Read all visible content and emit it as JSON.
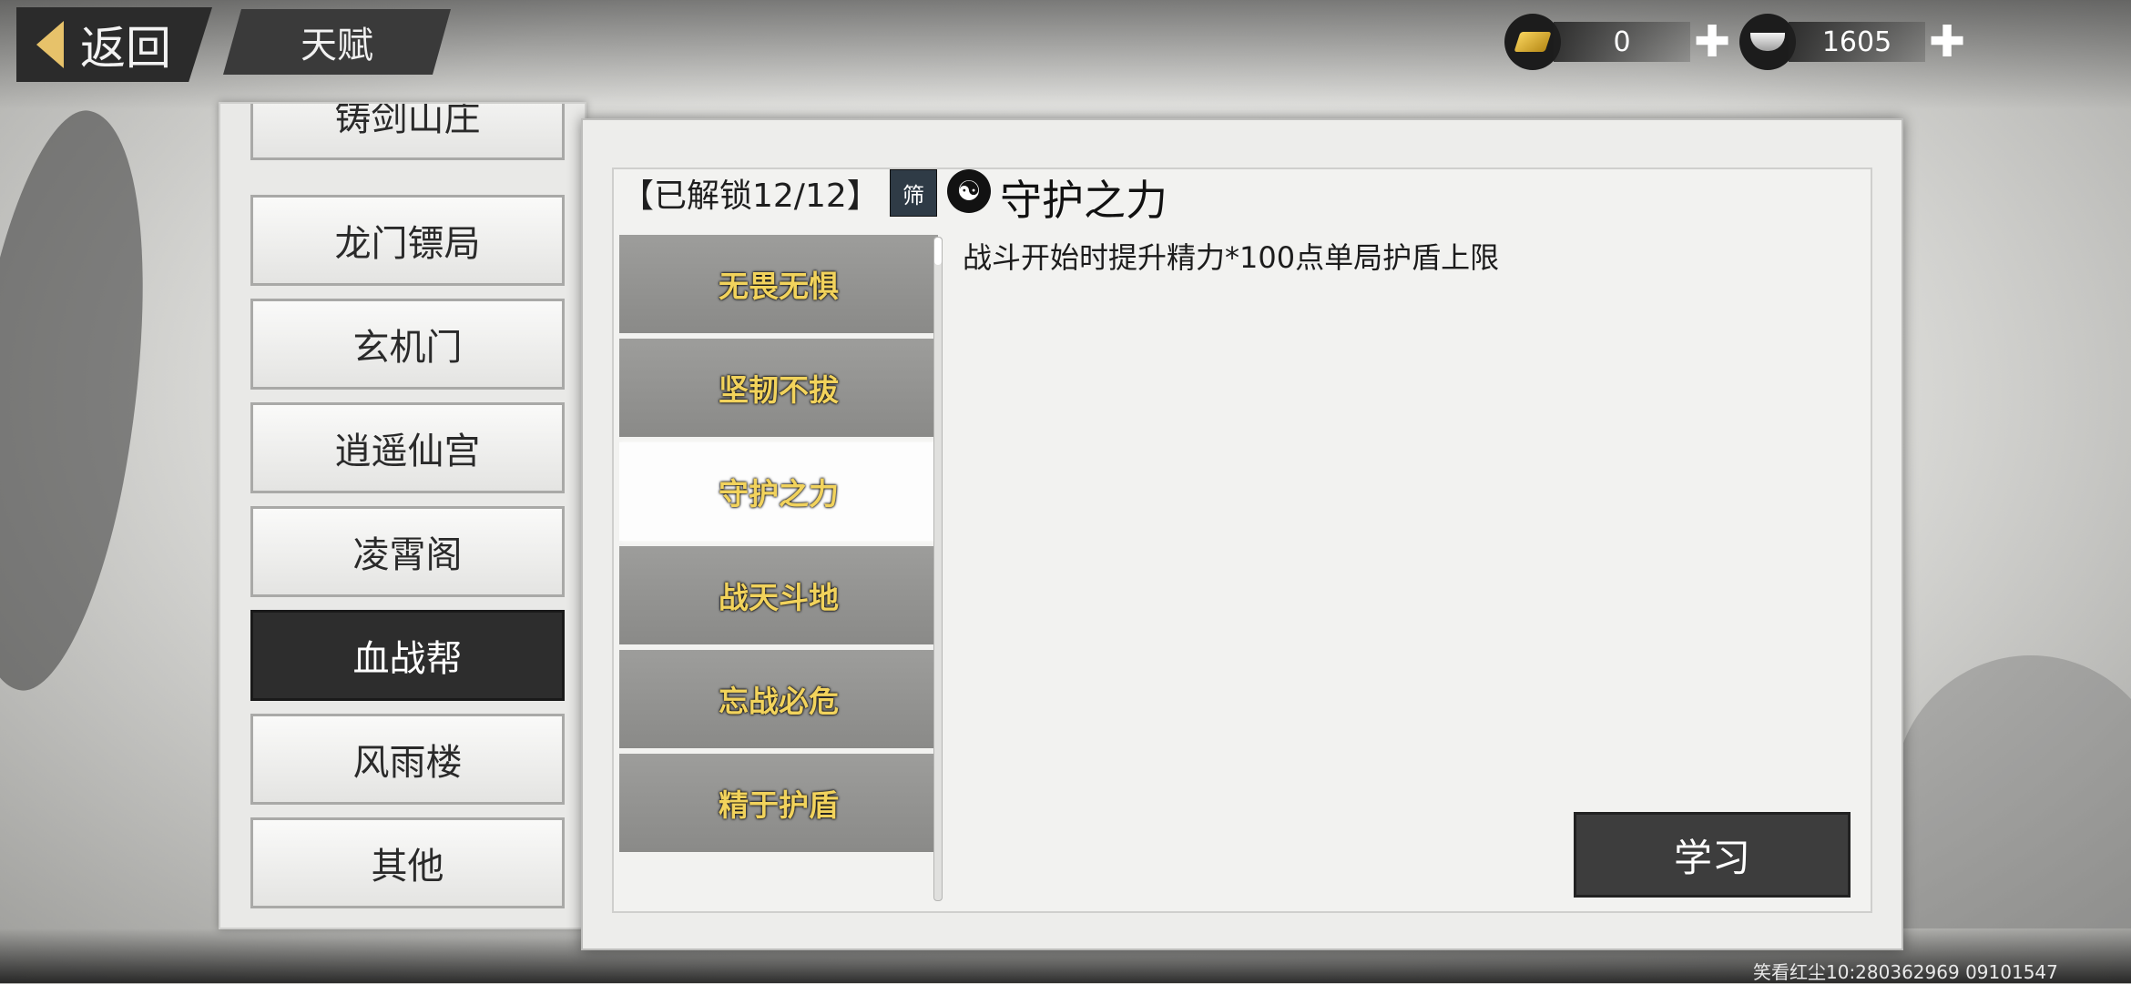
{
  "topbar": {
    "back_label": "返回",
    "page_title": "天赋",
    "gold": {
      "value": "0",
      "icon": "gold-ingot-icon"
    },
    "silver": {
      "value": "1605",
      "icon": "silver-ingot-icon"
    }
  },
  "sects": [
    {
      "label": "铸剑山庄",
      "active": false
    },
    {
      "label": "龙门镖局",
      "active": false
    },
    {
      "label": "玄机门",
      "active": false
    },
    {
      "label": "逍遥仙宫",
      "active": false
    },
    {
      "label": "凌霄阁",
      "active": false
    },
    {
      "label": "血战帮",
      "active": true
    },
    {
      "label": "风雨楼",
      "active": false
    },
    {
      "label": "其他",
      "active": false
    }
  ],
  "talents": {
    "unlock_label": "【已解锁12/12】",
    "filter_label": "筛",
    "selected_title": "守护之力",
    "selected_desc": "战斗开始时提升精力*100点单局护盾上限",
    "items": [
      {
        "label": "无畏无惧"
      },
      {
        "label": "坚韧不拔"
      },
      {
        "label": "守护之力"
      },
      {
        "label": "战天斗地"
      },
      {
        "label": "忘战必危"
      },
      {
        "label": "精于护盾"
      }
    ]
  },
  "learn_button": "学习",
  "watermark": "笑看红尘10:280362969  09101547"
}
